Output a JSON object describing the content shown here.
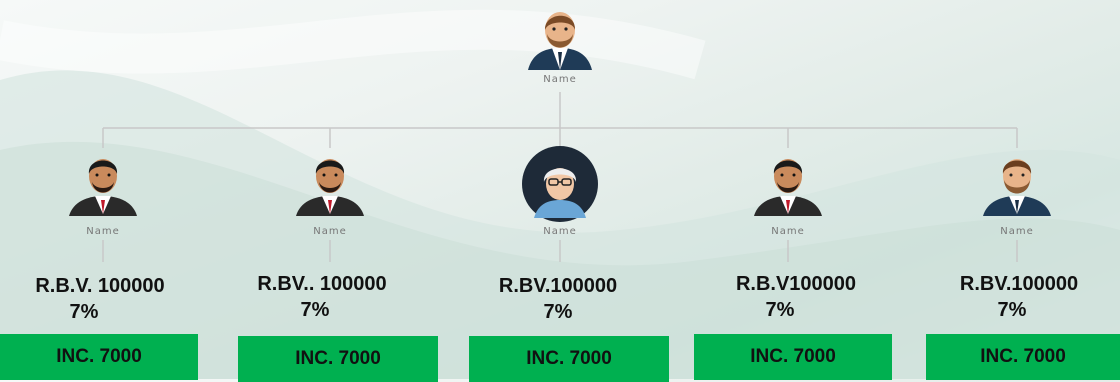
{
  "root": {
    "name": "Name"
  },
  "members": [
    {
      "name": "Name",
      "rbv": "R.B.V. 100000",
      "percent": "7%",
      "income": "INC. 7000",
      "avatar": "man-red-tie-icon"
    },
    {
      "name": "Name",
      "rbv": "R.BV.. 100000",
      "percent": "7%",
      "income": "INC. 7000",
      "avatar": "man-red-tie-icon"
    },
    {
      "name": "Name",
      "rbv": "R.BV.100000",
      "percent": "7%",
      "income": "INC. 7000",
      "avatar": "old-man-glasses-icon"
    },
    {
      "name": "Name",
      "rbv": "R.B.V100000",
      "percent": "7%",
      "income": "INC. 7000",
      "avatar": "man-red-tie-icon"
    },
    {
      "name": "Name",
      "rbv": "R.BV.100000",
      "percent": "7%",
      "income": "INC. 7000",
      "avatar": "bearded-man-icon"
    }
  ],
  "colors": {
    "income_box": "#00b050",
    "connector": "#c8c8c8",
    "text": "#111111"
  }
}
